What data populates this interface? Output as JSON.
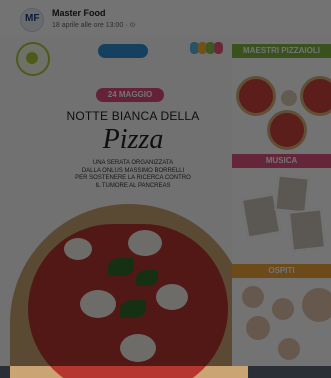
{
  "header": {
    "avatar_text": "MF",
    "page_name": "Master Food",
    "post_meta": "18 aprile alle ore 13:00 · ⊙"
  },
  "flyer": {
    "date": "24 MAGGIO",
    "title_line1": "NOTTE BIANCA DELLA",
    "title_line2": "Pizza",
    "description_lines": [
      "UNA SERATA ORGANIZZATA",
      "DALLA ONLUS MASSIMO BORRELLI",
      "PER SOSTENERE LA RICERCA CONTRO",
      "IL TUMORE AL PANCREAS"
    ],
    "sections": [
      {
        "label": "MAESTRI PIZZAIOLI"
      },
      {
        "label": "MUSICA"
      },
      {
        "label": "OSPITI"
      }
    ]
  },
  "colors": {
    "accent_pink": "#e04b7a",
    "section_green": "#7cb342",
    "section_pink": "#e05480",
    "section_orange": "#f0a53a"
  },
  "icons": [
    "page-avatar-icon",
    "globe-icon"
  ]
}
